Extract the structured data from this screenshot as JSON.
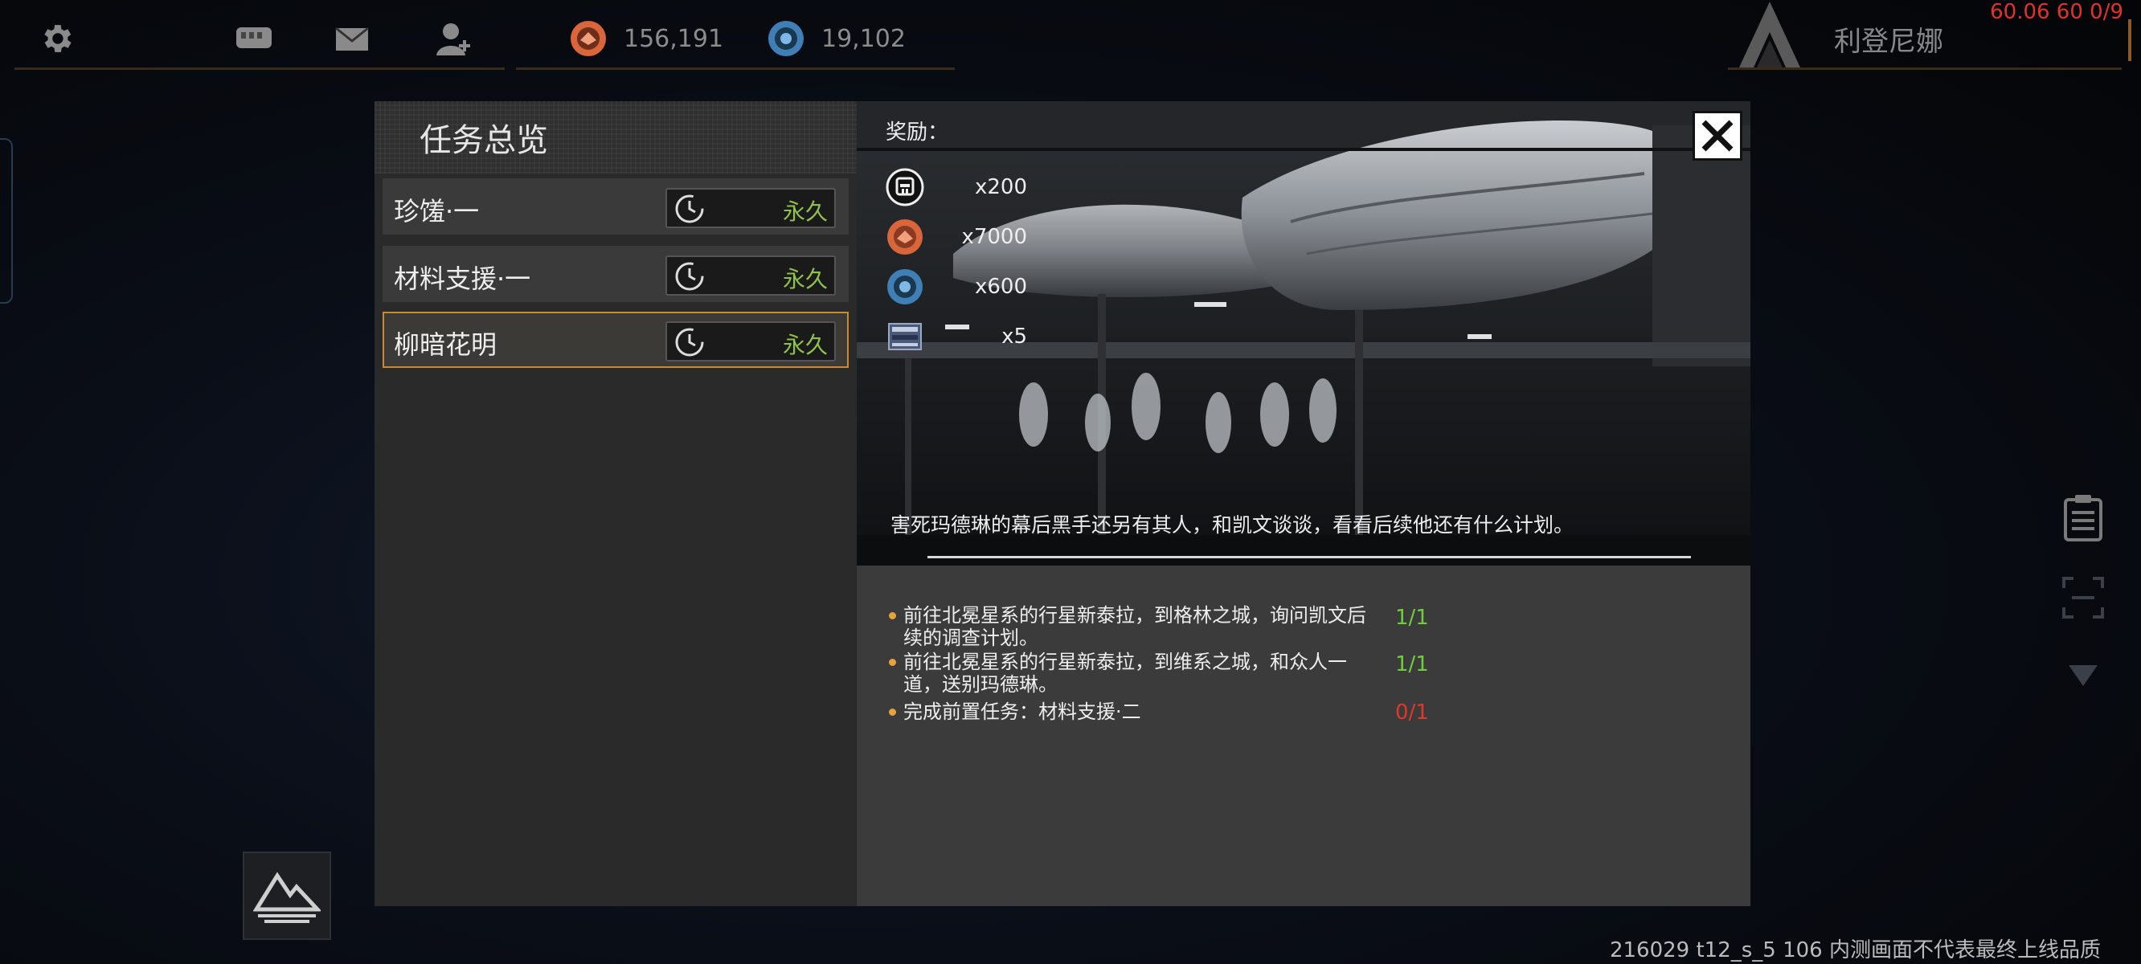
{
  "topbar": {
    "settings_icon": "gear-icon",
    "chat_icon": "chat-icon",
    "mail_icon": "mail-icon",
    "friends_icon": "friend-icon",
    "resources": [
      {
        "icon": "red-coin-icon",
        "value": "156,191",
        "color": "#e06a3c"
      },
      {
        "icon": "blue-coin-icon",
        "value": "19,102",
        "color": "#4a90c8"
      }
    ],
    "player_name": "利登尼娜",
    "debug_info": "60.06 60 0/9"
  },
  "quest_panel": {
    "title": "任务总览",
    "quests": [
      {
        "name": "珍馐·一",
        "duration": "永久",
        "selected": false
      },
      {
        "name": "材料支援·一",
        "duration": "永久",
        "selected": false
      },
      {
        "name": "柳暗花明",
        "duration": "永久",
        "selected": true
      }
    ]
  },
  "detail": {
    "reward_label": "奖励：",
    "rewards": [
      {
        "icon": "credit-chip-icon",
        "count": "x200"
      },
      {
        "icon": "red-coin-icon",
        "count": "x7000"
      },
      {
        "icon": "blue-coin-icon",
        "count": "x600"
      },
      {
        "icon": "ticket-icon",
        "count": "x5"
      }
    ],
    "story": "害死玛德琳的幕后黑手还另有其人，和凯文谈谈，看看后续他还有什么计划。",
    "objectives": [
      {
        "text": "前往北冕星系的行星新泰拉，到格林之城，询问凯文后续的调查计划。",
        "progress": "1/1",
        "done": true
      },
      {
        "text": "前往北冕星系的行星新泰拉，到维系之城，和众人一道，送别玛德琳。",
        "progress": "1/1",
        "done": true
      },
      {
        "text": "完成前置任务：材料支援·二",
        "progress": "0/1",
        "done": false
      }
    ],
    "colors": {
      "done": "#6fcf3a",
      "pending": "#e0362c"
    }
  },
  "footer": {
    "build_notice": "216029 t12_s_5 106 内测画面不代表最终上线品质"
  }
}
